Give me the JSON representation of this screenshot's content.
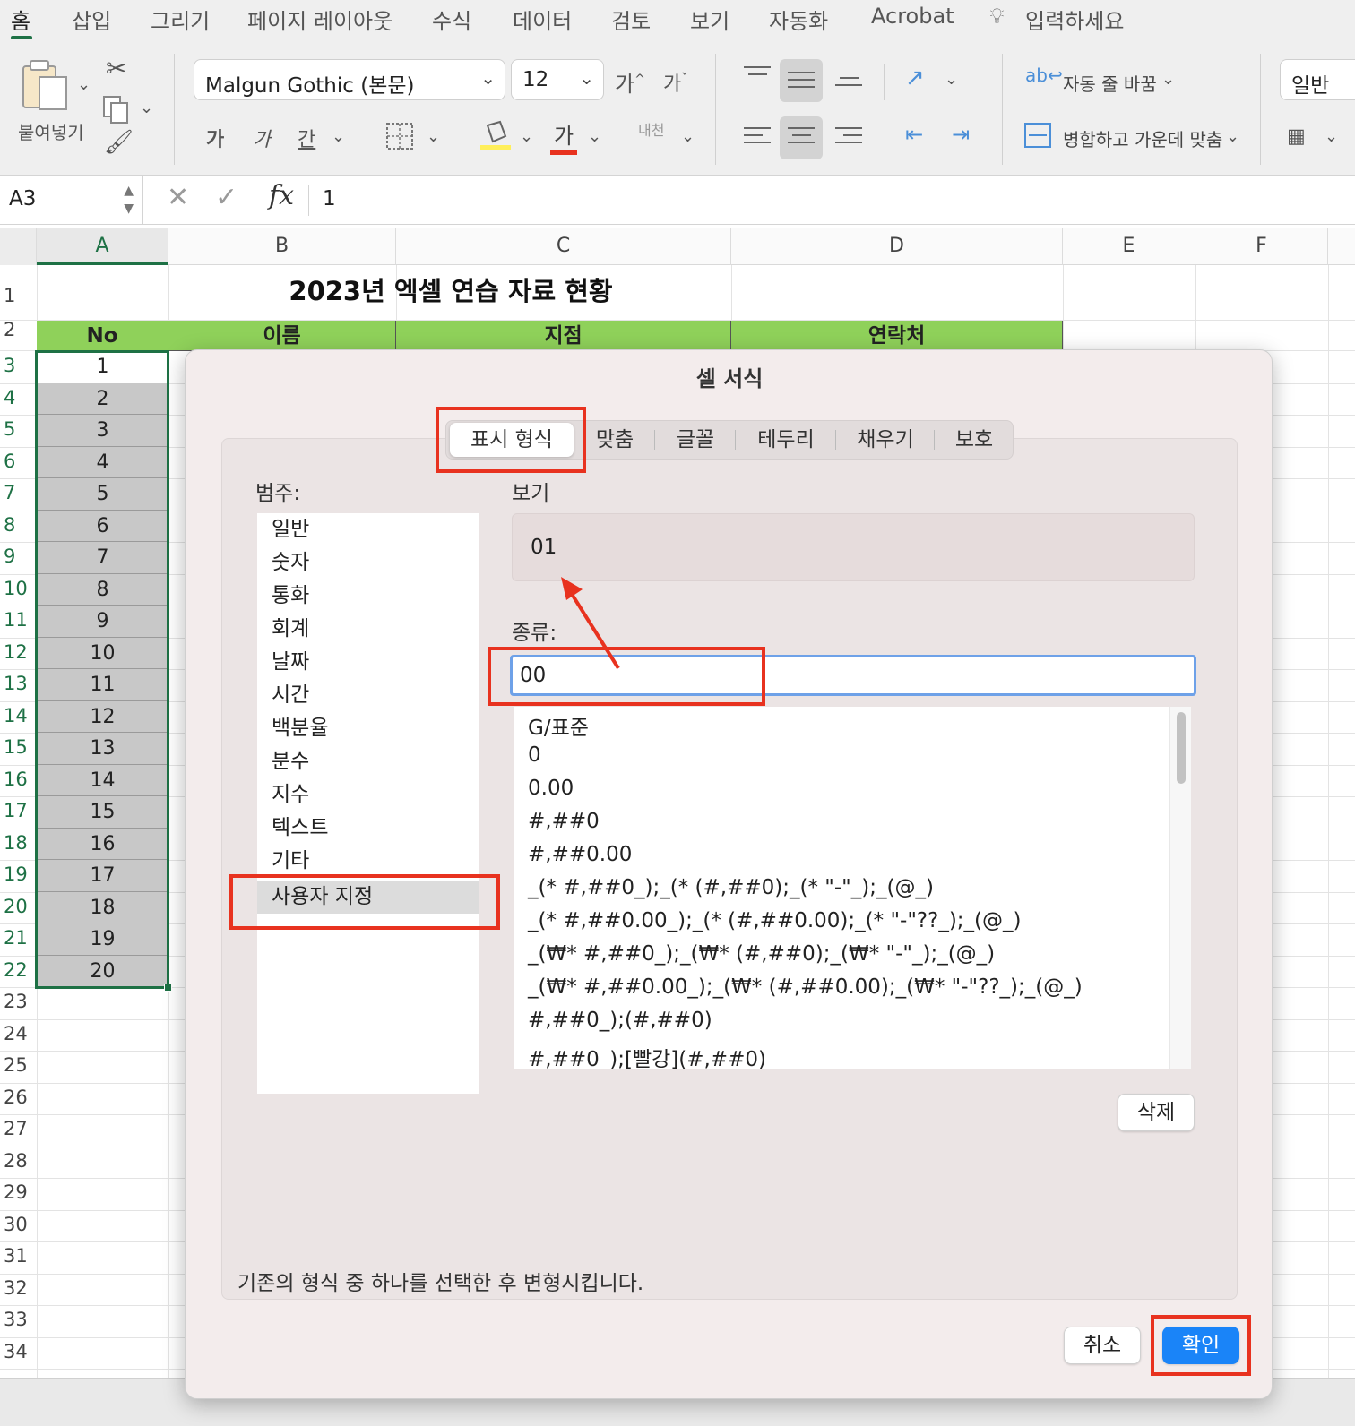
{
  "ribbon_tabs": [
    "홈",
    "삽입",
    "그리기",
    "페이지 레이아웃",
    "수식",
    "데이터",
    "검토",
    "보기",
    "자동화",
    "Acrobat",
    "입력하세요"
  ],
  "ribbon": {
    "paste_label": "붙여넣기",
    "font_name": "Malgun Gothic (본문)",
    "font_size": "12",
    "grow_font": "가",
    "shrink_font": "가",
    "bold": "가",
    "italic": "가",
    "underline": "간",
    "font_color_glyph": "가",
    "phonetic": "내천",
    "wrap_text": "자동 줄 바꿈",
    "merge_center": "병합하고 가운데 맞춤",
    "number_format": "일반"
  },
  "formula_bar": {
    "name_box": "A3",
    "fx": "fx",
    "value": "1"
  },
  "sheet": {
    "columns": [
      "A",
      "B",
      "C",
      "D",
      "E",
      "F"
    ],
    "rows": [
      "1",
      "2",
      "3",
      "4",
      "5",
      "6",
      "7",
      "8",
      "9",
      "10",
      "11",
      "12",
      "13",
      "14",
      "15",
      "16",
      "17",
      "18",
      "19",
      "20",
      "21",
      "22",
      "23",
      "24",
      "25",
      "26",
      "27",
      "28",
      "29",
      "30",
      "31",
      "32",
      "33",
      "34"
    ],
    "title": "2023년 엑셀 연습 자료 현황",
    "headers": [
      "No",
      "이름",
      "지점",
      "연락처"
    ],
    "col_a_values": [
      "1",
      "2",
      "3",
      "4",
      "5",
      "6",
      "7",
      "8",
      "9",
      "10",
      "11",
      "12",
      "13",
      "14",
      "15",
      "16",
      "17",
      "18",
      "19",
      "20"
    ],
    "header_fill_color": "#8fd15a",
    "selection_color": "#1e7145"
  },
  "dialog": {
    "title": "셀 서식",
    "tabs": [
      "표시 형식",
      "맞춤",
      "글꼴",
      "테두리",
      "채우기",
      "보호"
    ],
    "active_tab": "표시 형식",
    "category_label": "범주:",
    "categories": [
      "일반",
      "숫자",
      "통화",
      "회계",
      "날짜",
      "시간",
      "백분율",
      "분수",
      "지수",
      "텍스트",
      "기타",
      "사용자 지정"
    ],
    "selected_category": "사용자 지정",
    "preview_label": "보기",
    "preview_value": "01",
    "type_label": "종류:",
    "type_value": "00",
    "formats": [
      "G/표준",
      "0",
      "0.00",
      "#,##0",
      "#,##0.00",
      "_(* #,##0_);_(* (#,##0);_(* \"-\"_);_(@_)",
      "_(* #,##0.00_);_(* (#,##0.00);_(* \"-\"??_);_(@_)",
      "_(₩* #,##0_);_(₩* (#,##0);_(₩* \"-\"_);_(@_)",
      "_(₩* #,##0.00_);_(₩* (#,##0.00);_(₩* \"-\"??_);_(@_)",
      "#,##0_);(#,##0)",
      "#,##0_);[빨강](#,##0)"
    ],
    "delete_button": "삭제",
    "description": "기존의 형식 중 하나를 선택한 후 변형시킵니다.",
    "cancel_button": "취소",
    "ok_button": "확인",
    "accent_color": "#1a84f8",
    "annotation_color": "#e8321f"
  }
}
